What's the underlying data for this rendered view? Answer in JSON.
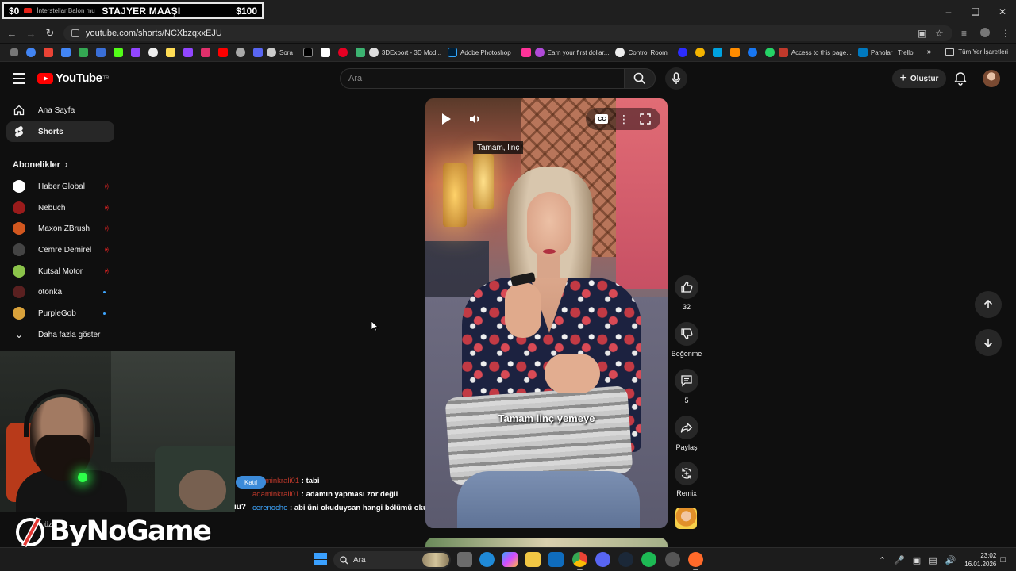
{
  "overlay": {
    "left_amount": "$0",
    "tab_title": "İnterstellar Balon mu",
    "goal_label": "STAJYER MAAŞI",
    "right_amount": "$100"
  },
  "browser": {
    "url": "youtube.com/shorts/NCXbzqxxEJU",
    "bookmarks": [
      {
        "label": "Sora"
      },
      {
        "label": "3DExport - 3D Mod..."
      },
      {
        "label": "Adobe Photoshop"
      },
      {
        "label": "Earn your first dollar..."
      },
      {
        "label": "Control Room"
      },
      {
        "label": "Access to this page..."
      },
      {
        "label": "Panolar | Trello"
      }
    ],
    "all_bookmarks": "Tüm Yer İşaretleri"
  },
  "youtube": {
    "logo_text": "YouTube",
    "logo_sup": "TR",
    "search_placeholder": "Ara",
    "create_label": "Oluştur",
    "nav": [
      {
        "label": "Ana Sayfa"
      },
      {
        "label": "Shorts"
      }
    ],
    "subscriptions_heading": "Abonelikler",
    "subscriptions": [
      {
        "name": "Haber Global",
        "status": "live",
        "color": "#ffffff"
      },
      {
        "name": "Nebuch",
        "status": "live",
        "color": "#9a1b1b"
      },
      {
        "name": "Maxon ZBrush",
        "status": "live",
        "color": "#d2571f"
      },
      {
        "name": "Cemre Demirel",
        "status": "live",
        "color": "#444444"
      },
      {
        "name": "Kutsal Motor",
        "status": "live",
        "color": "#8bc34a"
      },
      {
        "name": "otonka",
        "status": "new",
        "color": "#5a2020"
      },
      {
        "name": "PurpleGob",
        "status": "new",
        "color": "#d9a23b"
      }
    ],
    "show_more": "Daha fazla göster"
  },
  "short": {
    "caption_top": "Tamam, linç",
    "caption_burned": "Tamam linç yemeye",
    "cc_label": "CC",
    "actions": {
      "likes": "32",
      "dislike": "Beğenme",
      "comments": "5",
      "share": "Paylaş",
      "remix": "Remix"
    }
  },
  "chat": {
    "badge": "Katıl",
    "cut_text": "ıu?",
    "messages": [
      {
        "user": "adaminkrali01",
        "text": "tabi",
        "user_color": "#c0392b"
      },
      {
        "user": "adaminkrali01",
        "text": "adamın yapması zor değil",
        "user_color": "#c0392b"
      },
      {
        "user": "cerenocho",
        "text": "abi üni okuduysan hangi bölümü okudun",
        "user_color": "#3ea6ff"
      }
    ]
  },
  "stream_logo": "ByNoGame",
  "stream_logo_small": "üz",
  "taskbar": {
    "search": "Ara",
    "time": "23:02",
    "date": "16.01.2026"
  }
}
